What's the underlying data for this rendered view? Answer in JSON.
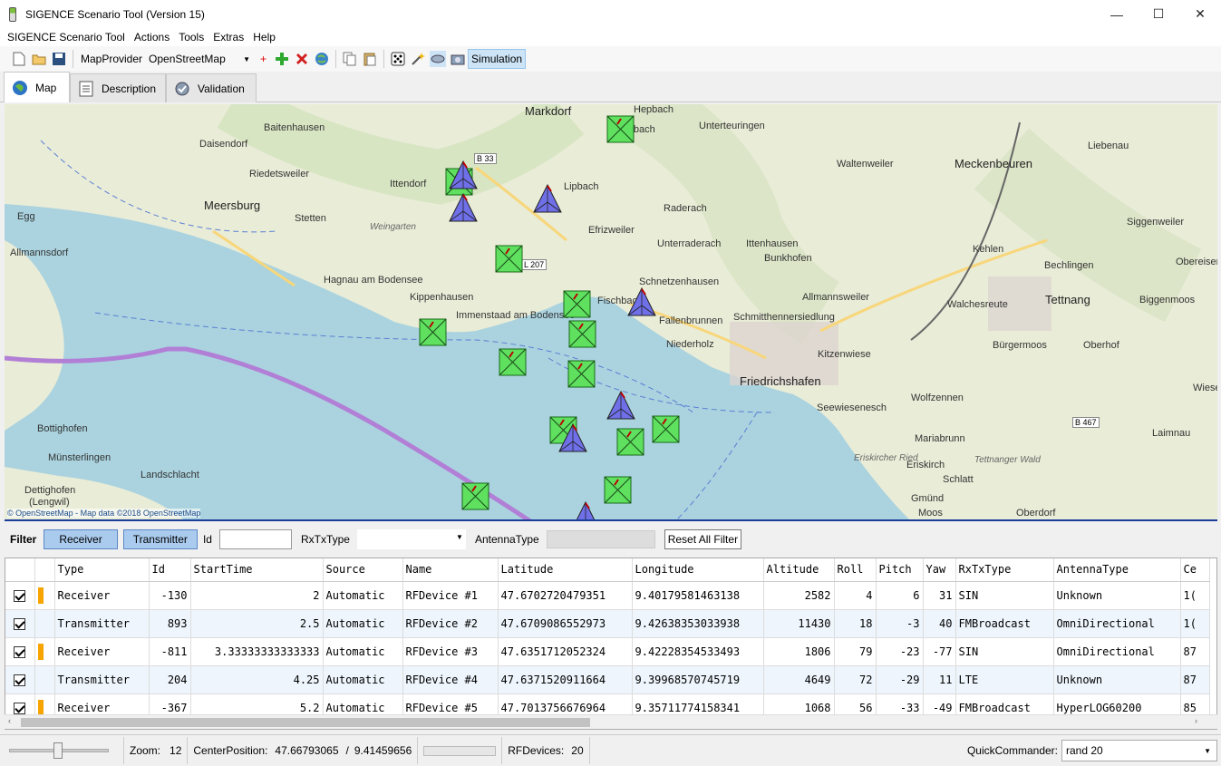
{
  "window": {
    "title": "SIGENCE Scenario Tool (Version 15)",
    "minimize": "—",
    "maximize": "☐",
    "close": "✕"
  },
  "menu": [
    "SIGENCE Scenario Tool",
    "Actions",
    "Tools",
    "Extras",
    "Help"
  ],
  "toolbar": {
    "map_provider_label": "MapProvider",
    "map_provider_value": "OpenStreetMap",
    "simulation_label": "Simulation",
    "plus_mark": "+"
  },
  "tabs": [
    "Map",
    "Description",
    "Validation"
  ],
  "map": {
    "places": [
      "Markdorf",
      "Hepbach",
      "Leimbach",
      "Baitenhausen",
      "Unterteuringen",
      "Liebenau",
      "Daisendorf",
      "B 33",
      "Waltenweiler",
      "Meckenbeuren",
      "Riedetsweiler",
      "Ittendorf",
      "Lipbach",
      "Egg",
      "Meersburg",
      "Stetten",
      "Weingarten",
      "Raderach",
      "Efrizweiler",
      "Siggenweiler",
      "Allmannsdorf",
      "Unterraderach",
      "Ittenhausen",
      "Kehlen",
      "Obereisen",
      "Bunkhofen",
      "Bechlingen",
      "L 207",
      "Hagnau am Bodensee",
      "Schnetzenhausen",
      "Tettnang",
      "Kippenhausen",
      "Fischbach",
      "Allmannsweiler",
      "Biggenmoos",
      "Immenstaad am Bodensee",
      "Fallenbrunnen",
      "Schmitthennersiedlung",
      "Walchesreute",
      "Niederholz",
      "Bürgermoos",
      "Oberhof",
      "Kitzenwiese",
      "Friedrichshafen",
      "Wiese",
      "Wolfzennen",
      "Seewiesenesch",
      "Bottighofen",
      "B 467",
      "Laimnau",
      "Mariabrunn",
      "Münsterlingen",
      "Eriskircher Ried",
      "Tettnanger Wald",
      "Landschlacht",
      "Eriskirch",
      "Schlatt",
      "Dettighofen",
      "(Lengwil)",
      "Gmünd",
      "Moos",
      "Oberdorf"
    ],
    "attribution": "© OpenStreetMap - Map data ©2018 OpenStreetMap"
  },
  "filter": {
    "label": "Filter",
    "receiver": "Receiver",
    "transmitter": "Transmitter",
    "id_label": "Id",
    "rxtx_label": "RxTxType",
    "antenna_label": "AntennaType",
    "reset": "Reset All Filter"
  },
  "grid": {
    "columns": [
      "Type",
      "Id",
      "StartTime",
      "Source",
      "Name",
      "Latitude",
      "Longitude",
      "Altitude",
      "Roll",
      "Pitch",
      "Yaw",
      "RxTxType",
      "AntennaType",
      "Ce"
    ],
    "rows": [
      [
        "Receiver",
        "-130",
        "2",
        "Automatic",
        "RFDevice #1",
        "47.6702720479351",
        "9.40179581463138",
        "2582",
        "4",
        "6",
        "31",
        "SIN",
        "Unknown",
        "1("
      ],
      [
        "Transmitter",
        "893",
        "2.5",
        "Automatic",
        "RFDevice #2",
        "47.6709086552973",
        "9.42638353033938",
        "11430",
        "18",
        "-3",
        "40",
        "FMBroadcast",
        "OmniDirectional",
        "1("
      ],
      [
        "Receiver",
        "-811",
        "3.33333333333333",
        "Automatic",
        "RFDevice #3",
        "47.6351712052324",
        "9.42228354533493",
        "1806",
        "79",
        "-23",
        "-77",
        "SIN",
        "OmniDirectional",
        "87"
      ],
      [
        "Transmitter",
        "204",
        "4.25",
        "Automatic",
        "RFDevice #4",
        "47.6371520911664",
        "9.39968570745719",
        "4649",
        "72",
        "-29",
        "11",
        "LTE",
        "Unknown",
        "87"
      ],
      [
        "Receiver",
        "-367",
        "5.2",
        "Automatic",
        "RFDevice #5",
        "47.7013756676964",
        "9.35711774158341",
        "1068",
        "56",
        "-33",
        "-49",
        "FMBroadcast",
        "HyperLOG60200",
        "85"
      ]
    ]
  },
  "status": {
    "zoom_label": "Zoom:",
    "zoom_value": "12",
    "center_label": "CenterPosition:",
    "center_lat": "47.66793065",
    "center_sep": "/",
    "center_lon": "9.41459656",
    "rfdevices_label": "RFDevices:",
    "rfdevices_value": "20",
    "quickcommander_label": "QuickCommander:",
    "quickcommander_value": "rand 20"
  },
  "colors": {
    "water": "#aad3df",
    "receiver": "#5fe05f",
    "transmitter": "#6f6fe8",
    "route": "#b27fd6",
    "selected_button": "#aacbee"
  }
}
